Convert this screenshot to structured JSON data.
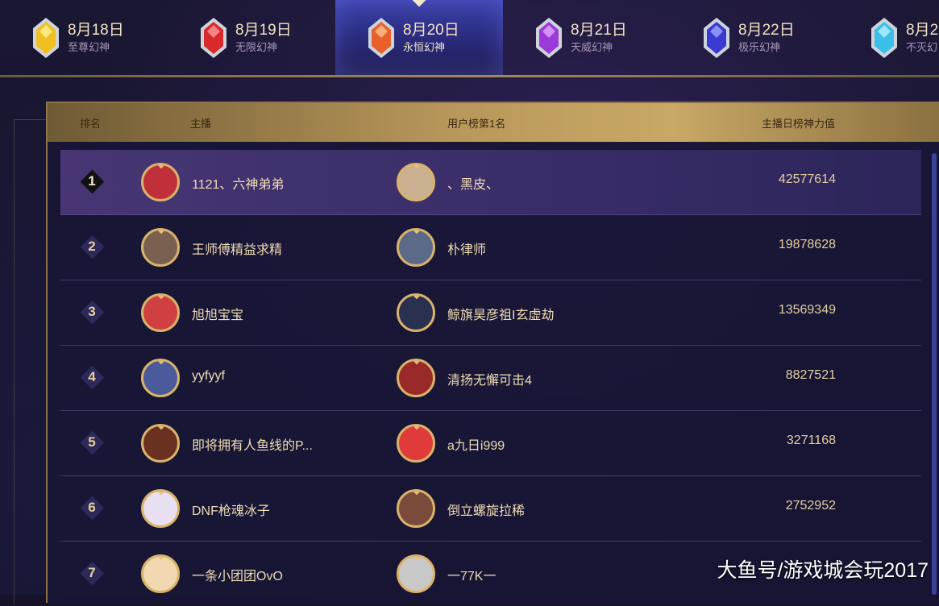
{
  "tabs": [
    {
      "date": "8月18日",
      "name": "至尊幻神",
      "gem_color": "#f0c020",
      "active": false
    },
    {
      "date": "8月19日",
      "name": "无限幻神",
      "gem_color": "#d82a2a",
      "active": false
    },
    {
      "date": "8月20日",
      "name": "永恒幻神",
      "gem_color": "#e8602a",
      "active": true
    },
    {
      "date": "8月21日",
      "name": "天威幻神",
      "gem_color": "#9a3ad8",
      "active": false
    },
    {
      "date": "8月22日",
      "name": "极乐幻神",
      "gem_color": "#3a3ad0",
      "active": false
    },
    {
      "date": "8月2",
      "name": "不灭幻",
      "gem_color": "#3ac0e8",
      "active": false
    }
  ],
  "table": {
    "headers": {
      "rank": "排名",
      "streamer": "主播",
      "top_user": "用户榜第1名",
      "power": "主播日榜神力值"
    },
    "rows": [
      {
        "rank": "1",
        "streamer": "1121、六神弟弟",
        "top_user": "、黑皮、",
        "power": "42577614",
        "av1": "#c0303a",
        "av2": "#c8b090"
      },
      {
        "rank": "2",
        "streamer": "王师傅精益求精",
        "top_user": "朴律师",
        "power": "19878628",
        "av1": "#7a6050",
        "av2": "#5a6a88"
      },
      {
        "rank": "3",
        "streamer": "旭旭宝宝",
        "top_user": "鲸旗昊彦祖I玄虚劫",
        "power": "13569349",
        "av1": "#d04040",
        "av2": "#2a3050"
      },
      {
        "rank": "4",
        "streamer": "yyfyyf",
        "top_user": "清扬无懈可击4",
        "power": "8827521",
        "av1": "#4a5a9a",
        "av2": "#9a2a2a"
      },
      {
        "rank": "5",
        "streamer": "即将拥有人鱼线的P...",
        "top_user": "a九日i999",
        "power": "3271168",
        "av1": "#6a3020",
        "av2": "#e03a3a"
      },
      {
        "rank": "6",
        "streamer": "DNF枪魂冰子",
        "top_user": "倒立螺旋拉稀",
        "power": "2752952",
        "av1": "#e8e0f0",
        "av2": "#7a4a3a"
      },
      {
        "rank": "7",
        "streamer": "一条小团团OvO",
        "top_user": "一77K一",
        "power": "",
        "av1": "#f0d8b0",
        "av2": "#c8c8c8"
      }
    ]
  },
  "watermark": "大鱼号/游戏城会玩2017"
}
